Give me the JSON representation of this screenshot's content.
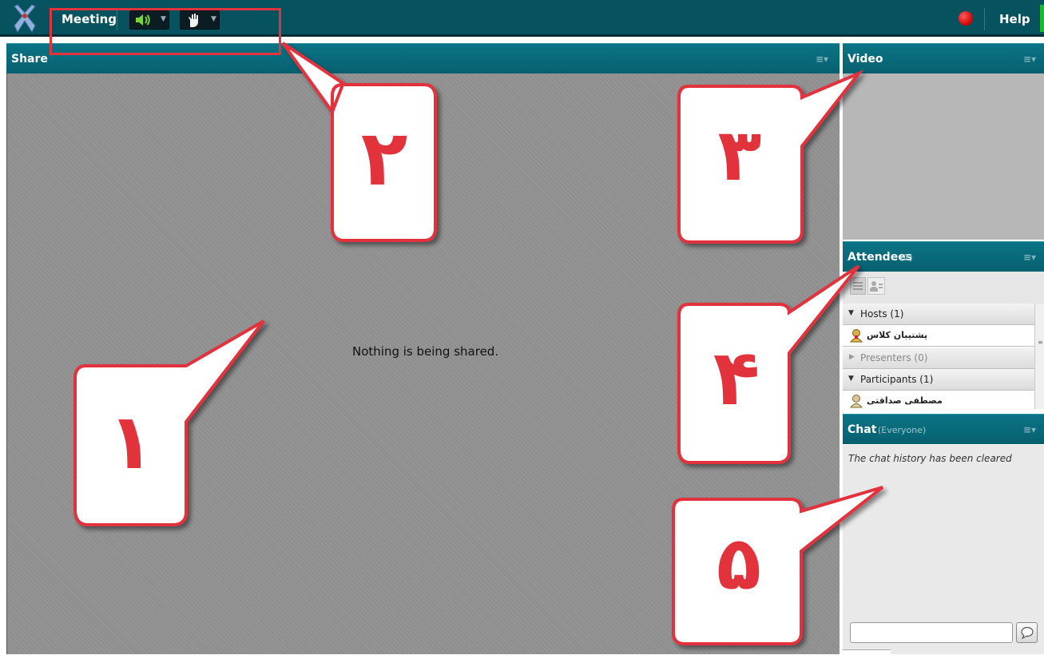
{
  "menubar": {
    "meeting_label": "Meeting",
    "help_label": "Help",
    "audio_icon": "speaker-icon",
    "mic_icon": "raise-hand-icon"
  },
  "share": {
    "title": "Share",
    "message": "Nothing is being shared."
  },
  "video": {
    "title": "Video"
  },
  "attendees": {
    "title": "Attendees",
    "count": "(2)",
    "hosts_label": "Hosts (1)",
    "host_name": "پشتیبان کلاس",
    "presenters_label": "Presenters (0)",
    "participants_label": "Participants (1)",
    "participant_name": "مصطفی صداقتی"
  },
  "chat": {
    "title": "Chat",
    "audience": "(Everyone)",
    "message": "The chat history has been cleared",
    "input_value": ""
  },
  "callouts": [
    "۱",
    "۲",
    "۳",
    "۴",
    "۵"
  ],
  "colors": {
    "header_teal": "#06535f",
    "annotation_red": "#e2323c"
  }
}
